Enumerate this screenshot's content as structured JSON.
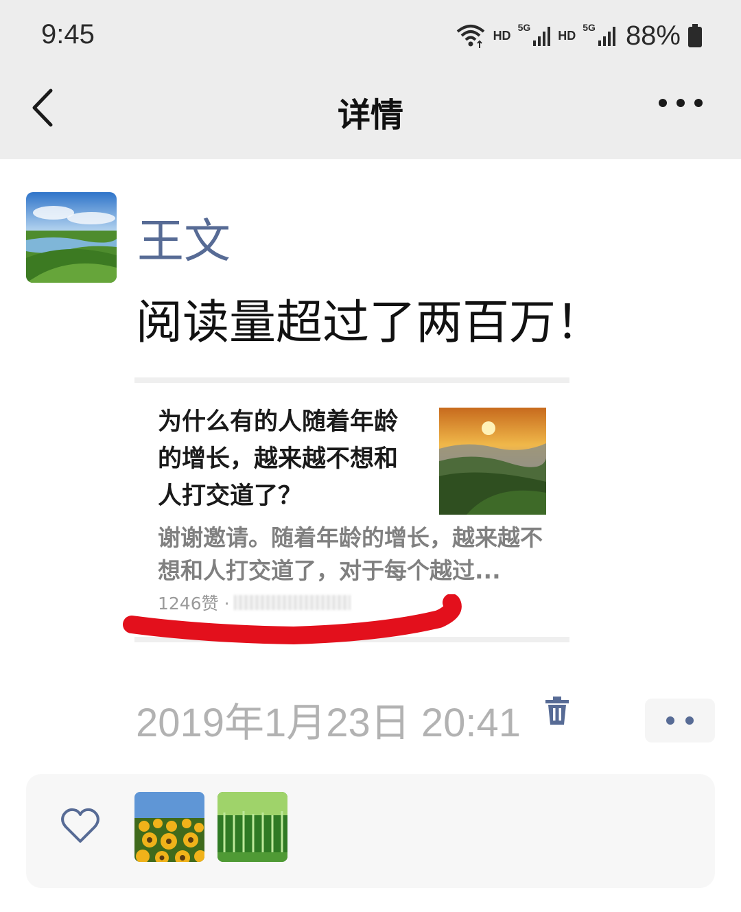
{
  "status_bar": {
    "time": "9:45",
    "hd1": "HD",
    "net1": "5G",
    "hd2": "HD",
    "net2": "5G",
    "battery": "88%"
  },
  "nav": {
    "title": "详情"
  },
  "post": {
    "author": "王文",
    "text": "阅读量超过了两百万！",
    "shared_article": {
      "title": "为什么有的人随着年龄的增长，越来越不想和人打交道了？",
      "summary": "谢谢邀请。随着年龄的增长，越来越不想和人打交道了，对于每个越过...",
      "likes": "1246赞 ·"
    },
    "timestamp": "2019年1月23日 20:41"
  },
  "colors": {
    "link_blue": "#576b95",
    "annotation_red": "#e3101c",
    "header_bg": "#ededed"
  },
  "icons": [
    "back-chevron-icon",
    "more-dots-icon",
    "trash-icon",
    "heart-icon",
    "wifi-icon",
    "signal-icon",
    "battery-icon"
  ]
}
